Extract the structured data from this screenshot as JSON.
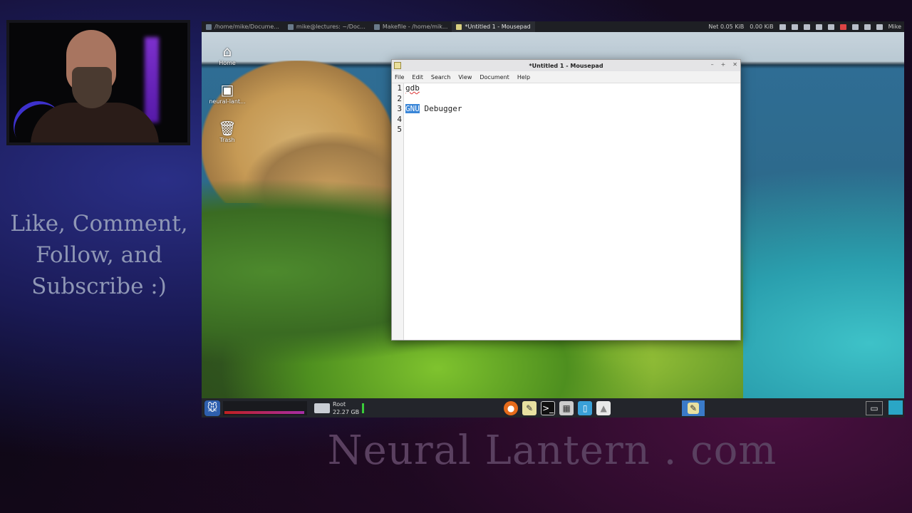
{
  "overlay": {
    "cta_lines": [
      "Like, Comment,",
      "Follow, and",
      "Subscribe :)"
    ],
    "brand": "Neural Lantern . com"
  },
  "top_panel": {
    "tasks": [
      {
        "label": "/home/mike/Docume...",
        "active": false
      },
      {
        "label": "mike@lectures: ~/Doc...",
        "active": false
      },
      {
        "label": "Makefile - /home/mik...",
        "active": false
      },
      {
        "label": "*Untitled 1 - Mousepad",
        "active": true
      }
    ],
    "net_label": "Net 0.05 KiB",
    "net2_label": "0.00 KiB",
    "user_label": "Mike"
  },
  "desktop_icons": [
    {
      "label": "Home",
      "icon": "home-icon"
    },
    {
      "label": "neural-lant...",
      "icon": "folder-icon"
    },
    {
      "label": "Trash",
      "icon": "trash-icon"
    }
  ],
  "window": {
    "title": "*Untitled 1 - Mousepad",
    "menu": [
      "File",
      "Edit",
      "Search",
      "View",
      "Document",
      "Help"
    ],
    "line_numbers": [
      "1",
      "2",
      "3",
      "4",
      "5"
    ],
    "lines": {
      "l1": "gdb",
      "l3_selected": "GNU",
      "l3_rest": " Debugger"
    }
  },
  "bottom_panel": {
    "disk_name": "Root",
    "disk_size": "22.27 GB"
  },
  "colors": {
    "selection": "#3a86d8",
    "panel": "#23252b",
    "task_active": "#3a7ac8"
  }
}
